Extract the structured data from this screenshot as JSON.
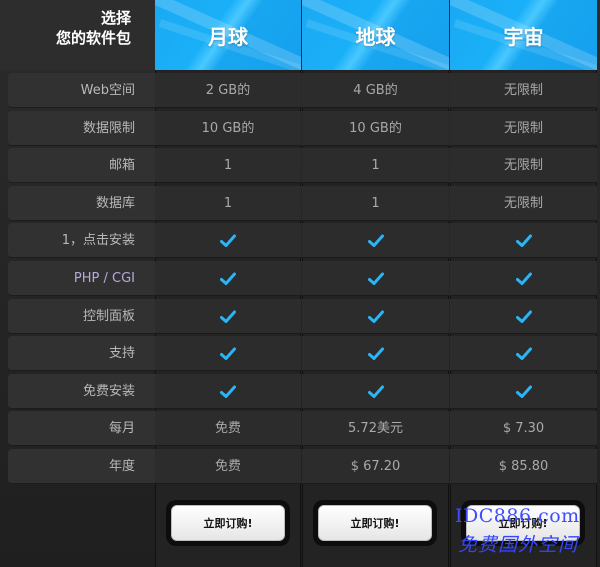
{
  "header": {
    "line1": "选择",
    "line2": "您的软件包"
  },
  "plans": [
    {
      "name": "月球"
    },
    {
      "name": "地球"
    },
    {
      "name": "宇宙"
    }
  ],
  "rows": [
    {
      "label": "Web空间",
      "values": [
        "2 GB的",
        "4 GB的",
        "无限制"
      ]
    },
    {
      "label": "数据限制",
      "values": [
        "10 GB的",
        "10 GB的",
        "无限制"
      ]
    },
    {
      "label": "邮箱",
      "values": [
        "1",
        "1",
        "无限制"
      ]
    },
    {
      "label": "数据库",
      "values": [
        "1",
        "1",
        "无限制"
      ]
    },
    {
      "label": "1，点击安装",
      "values": [
        "check",
        "check",
        "check"
      ]
    },
    {
      "label": "PHP / CGI",
      "values": [
        "check",
        "check",
        "check"
      ]
    },
    {
      "label": "控制面板",
      "values": [
        "check",
        "check",
        "check"
      ]
    },
    {
      "label": "支持",
      "values": [
        "check",
        "check",
        "check"
      ]
    },
    {
      "label": "免费安装",
      "values": [
        "check",
        "check",
        "check"
      ]
    },
    {
      "label": "每月",
      "values": [
        "免费",
        "5.72美元",
        "$ 7.30"
      ]
    },
    {
      "label": "年度",
      "values": [
        "免费",
        "$ 67.20",
        "$ 85.80"
      ]
    }
  ],
  "buttons": {
    "order_label": "立即订购!"
  },
  "watermark": {
    "line1": "IDC886.com",
    "line2": "免费国外空间"
  },
  "colors": {
    "accent_blue": "#1aa9f3",
    "check_blue": "#29b6f6",
    "watermark": "#3f4cff"
  },
  "icons": {
    "check": "check-icon"
  }
}
